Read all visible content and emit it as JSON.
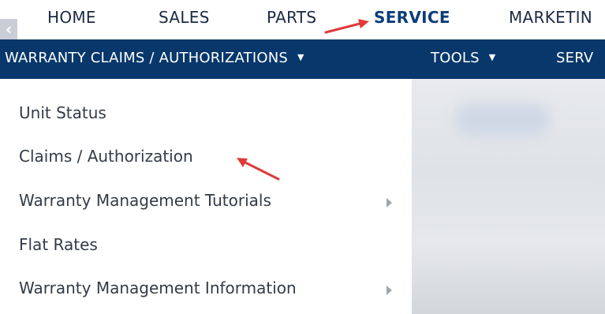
{
  "top_nav": {
    "back_icon": "chevron-left-icon",
    "tabs": [
      {
        "label": "HOME"
      },
      {
        "label": "SALES"
      },
      {
        "label": "PARTS"
      },
      {
        "label": "SERVICE",
        "active": true
      },
      {
        "label": "MARKETIN"
      }
    ]
  },
  "sub_nav": {
    "items": [
      {
        "label": "WARRANTY CLAIMS / AUTHORIZATIONS",
        "icon": "caret-down-icon"
      },
      {
        "label": "TOOLS",
        "icon": "caret-down-icon"
      },
      {
        "label": "SERV"
      }
    ]
  },
  "dropdown": {
    "items": [
      {
        "label": "Unit Status"
      },
      {
        "label": "Claims / Authorization"
      },
      {
        "label": "Warranty Management Tutorials",
        "has_submenu": true
      },
      {
        "label": "Flat Rates"
      },
      {
        "label": "Warranty Management Information",
        "has_submenu": true
      }
    ]
  },
  "colors": {
    "subnav_bg": "#07376b",
    "active_tab": "#0d3d7a",
    "annotation_arrow": "#e03a3a"
  }
}
